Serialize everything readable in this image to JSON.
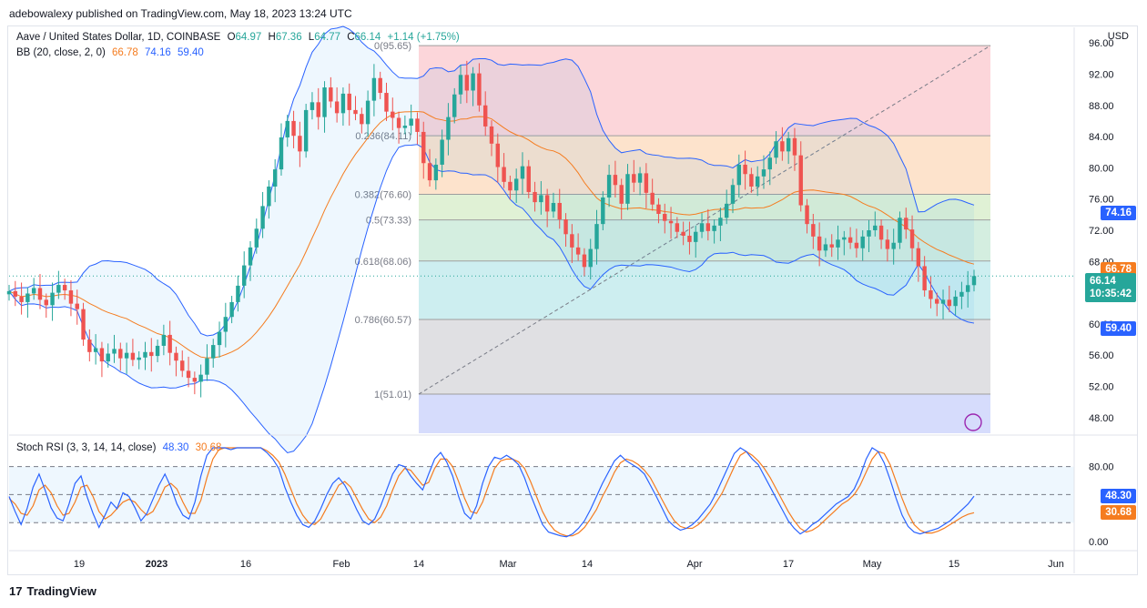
{
  "header": {
    "publisher_line": "adebowalexy published on TradingView.com, May 18, 2023 13:24 UTC"
  },
  "legend": {
    "symbol": "Aave / United States Dollar, 1D, COINBASE",
    "ohlc": [
      {
        "label": "O",
        "value": "64.97"
      },
      {
        "label": "H",
        "value": "67.36"
      },
      {
        "label": "L",
        "value": "64.77"
      },
      {
        "label": "C",
        "value": "66.14"
      }
    ],
    "change": "+1.14 (+1.75%)",
    "bb_label": "BB (20, close, 2, 0)",
    "bb_values": [
      "66.78",
      "74.16",
      "59.40"
    ],
    "rsi_label": "Stoch RSI (3, 3, 14, 14, close)",
    "rsi_values": [
      "48.30",
      "30.68"
    ]
  },
  "price_axis": {
    "currency": "USD",
    "ticks": [
      "96.00",
      "92.00",
      "88.00",
      "84.00",
      "80.00",
      "76.00",
      "72.00",
      "68.00",
      "64.00",
      "60.00",
      "56.00",
      "52.00",
      "48.00"
    ]
  },
  "rsi_axis": {
    "ticks": [
      "80.00",
      "0.00"
    ]
  },
  "badges": {
    "bb_upper": "74.16",
    "bb_basis": "66.78",
    "last_price": "66.14",
    "countdown": "10:35:42",
    "bb_lower": "59.40",
    "rsi_k": "48.30",
    "rsi_d": "30.68"
  },
  "time_axis": [
    "19",
    "2023",
    "16",
    "Feb",
    "14",
    "Mar",
    "14",
    "Apr",
    "17",
    "May",
    "15",
    "Jun"
  ],
  "footer": {
    "brand": "TradingView"
  },
  "colors": {
    "up": "#26a69a",
    "down": "#ef5350",
    "bb_basis": "#f57c1f",
    "bb_band": "#2962ff",
    "rsi_k": "#2962ff",
    "rsi_d": "#f57c1f"
  },
  "chart_data": [
    {
      "type": "candlestick",
      "title": "Aave / United States Dollar, 1D, COINBASE",
      "ylabel": "USD",
      "ylim": [
        46,
        98
      ],
      "fib_levels": [
        {
          "label": "0(95.65)",
          "ratio": 0,
          "price": 95.65,
          "fill": "#fcd6da"
        },
        {
          "label": "0.236(84.11)",
          "ratio": 0.236,
          "price": 84.11,
          "fill": "#fde3cc"
        },
        {
          "label": "0.382(76.60)",
          "ratio": 0.382,
          "price": 76.6,
          "fill": "#e0f1d5"
        },
        {
          "label": "0.5(73.33)",
          "ratio": 0.5,
          "price": 73.33,
          "fill": "#d4eee0"
        },
        {
          "label": "0.618(68.06)",
          "ratio": 0.618,
          "price": 68.06,
          "fill": "#cdeef0"
        },
        {
          "label": "0.786(60.57)",
          "ratio": 0.786,
          "price": 60.57,
          "fill": "#e0e0e3"
        },
        {
          "label": "1(51.01)",
          "ratio": 1,
          "price": 51.01,
          "fill": "#d6dcfc"
        }
      ],
      "closes": [
        64.2,
        63.5,
        62.8,
        63.9,
        64.6,
        63.1,
        62.4,
        64.0,
        65.0,
        64.3,
        62.6,
        61.9,
        58.0,
        56.4,
        56.9,
        55.2,
        56.2,
        56.8,
        55.6,
        56.3,
        55.4,
        55.7,
        56.4,
        55.9,
        57.2,
        58.6,
        56.3,
        55.3,
        54.0,
        53.1,
        52.6,
        53.5,
        55.6,
        57.3,
        59.0,
        60.9,
        62.8,
        64.9,
        67.5,
        69.8,
        72.2,
        75.1,
        77.6,
        79.8,
        83.9,
        86.0,
        84.1,
        82.1,
        87.4,
        88.4,
        86.5,
        90.3,
        88.5,
        87.0,
        89.5,
        87.4,
        86.9,
        85.6,
        88.6,
        91.5,
        89.6,
        87.2,
        86.4,
        85.1,
        85.4,
        86.3,
        84.6,
        80.6,
        78.4,
        80.4,
        83.6,
        86.5,
        89.4,
        91.9,
        89.9,
        92.1,
        88.0,
        85.3,
        83.1,
        80.1,
        78.2,
        77.1,
        78.6,
        80.2,
        76.9,
        75.6,
        76.5,
        74.4,
        75.5,
        73.4,
        71.5,
        69.8,
        68.9,
        67.3,
        69.6,
        72.8,
        76.2,
        79.1,
        77.8,
        75.4,
        79.2,
        78.1,
        79.3,
        76.8,
        75.3,
        74.1,
        73.2,
        72.9,
        71.8,
        71.3,
        70.5,
        71.8,
        72.9,
        71.9,
        72.6,
        73.6,
        75.4,
        77.8,
        80.4,
        79.2,
        77.6,
        78.9,
        79.8,
        81.3,
        83.4,
        82.1,
        83.8,
        81.6,
        75.2,
        72.8,
        71.2,
        69.4,
        70.2,
        69.8,
        70.8,
        71.1,
        70.4,
        69.7,
        71.2,
        72.0,
        72.6,
        70.8,
        69.6,
        70.4,
        73.6,
        72.1,
        69.7,
        67.4,
        64.3,
        63.2,
        62.6,
        63.1,
        62.3,
        63.5,
        64.1,
        64.97,
        66.14
      ]
    },
    {
      "type": "line",
      "title": "Stoch RSI (3, 3, 14, 14, close)",
      "ylim": [
        -5,
        100
      ],
      "series": [
        {
          "name": "K",
          "values": [
            48,
            32,
            18,
            35,
            58,
            72,
            55,
            36,
            25,
            22,
            40,
            62,
            70,
            48,
            30,
            15,
            28,
            42,
            35,
            52,
            48,
            36,
            22,
            30,
            45,
            60,
            72,
            58,
            40,
            28,
            24,
            42,
            70,
            92,
            100,
            100,
            100,
            98,
            100,
            100,
            100,
            100,
            100,
            95,
            88,
            78,
            58,
            42,
            28,
            18,
            15,
            22,
            35,
            50,
            62,
            68,
            60,
            48,
            34,
            22,
            18,
            24,
            38,
            55,
            72,
            82,
            80,
            70,
            62,
            55,
            72,
            88,
            95,
            85,
            70,
            48,
            30,
            24,
            38,
            62,
            80,
            90,
            88,
            92,
            88,
            82,
            68,
            50,
            34,
            18,
            10,
            8,
            6,
            5,
            8,
            14,
            22,
            34,
            48,
            62,
            74,
            86,
            92,
            86,
            82,
            78,
            72,
            60,
            48,
            35,
            22,
            16,
            12,
            14,
            18,
            24,
            32,
            40,
            52,
            66,
            80,
            94,
            100,
            96,
            88,
            82,
            70,
            58,
            46,
            34,
            22,
            14,
            8,
            12,
            18,
            22,
            28,
            34,
            40,
            44,
            48,
            56,
            70,
            88,
            100,
            96,
            84,
            66,
            46,
            28,
            16,
            10,
            8,
            10,
            12,
            14,
            18,
            22,
            28,
            34,
            40,
            48.3
          ]
        },
        {
          "name": "D",
          "values": [
            46,
            40,
            30,
            28,
            38,
            55,
            60,
            52,
            38,
            28,
            30,
            42,
            58,
            60,
            48,
            32,
            24,
            28,
            35,
            42,
            45,
            42,
            34,
            28,
            32,
            44,
            58,
            62,
            56,
            42,
            30,
            30,
            44,
            68,
            88,
            98,
            100,
            100,
            100,
            100,
            100,
            100,
            100,
            97,
            92,
            85,
            72,
            56,
            40,
            28,
            20,
            18,
            24,
            36,
            48,
            60,
            64,
            58,
            46,
            34,
            24,
            20,
            26,
            38,
            55,
            70,
            78,
            76,
            68,
            60,
            63,
            78,
            88,
            88,
            80,
            64,
            46,
            32,
            30,
            42,
            60,
            78,
            86,
            88,
            88,
            85,
            78,
            64,
            48,
            32,
            20,
            12,
            8,
            6,
            6,
            9,
            15,
            24,
            34,
            48,
            60,
            74,
            84,
            88,
            86,
            82,
            76,
            68,
            56,
            44,
            32,
            22,
            16,
            14,
            14,
            18,
            24,
            32,
            42,
            52,
            66,
            80,
            92,
            96,
            92,
            86,
            78,
            68,
            56,
            44,
            32,
            22,
            14,
            10,
            12,
            16,
            22,
            28,
            34,
            40,
            44,
            50,
            60,
            74,
            88,
            96,
            94,
            82,
            64,
            46,
            30,
            18,
            12,
            9,
            9,
            11,
            14,
            18,
            22,
            26,
            29,
            30.68
          ]
        }
      ]
    }
  ]
}
